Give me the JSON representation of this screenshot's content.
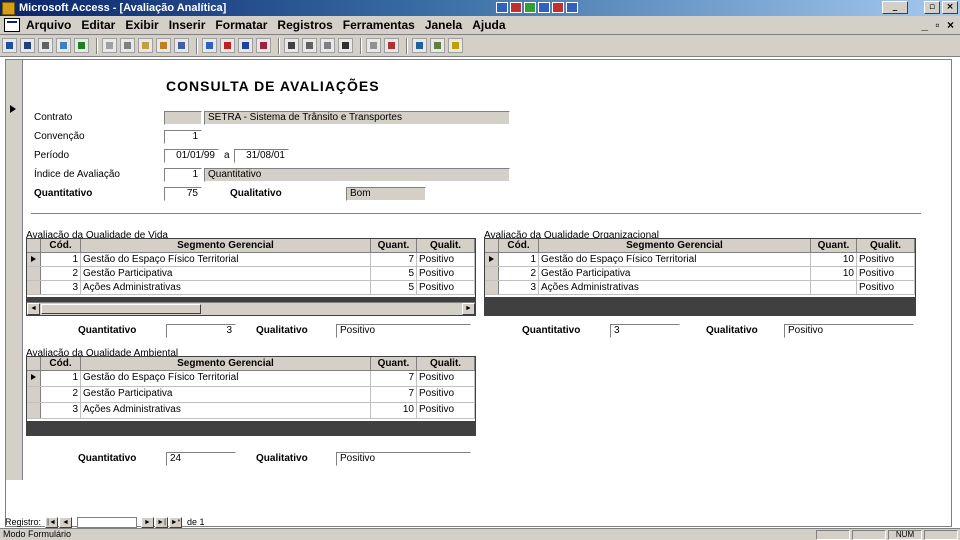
{
  "window": {
    "title": "Microsoft Access - [Avaliação Analítica]",
    "minimize_glyph": "_",
    "restore_glyph": "▫",
    "close_glyph": "×"
  },
  "menu": {
    "items": [
      "Arquivo",
      "Editar",
      "Exibir",
      "Inserir",
      "Formatar",
      "Registros",
      "Ferramentas",
      "Janela",
      "Ajuda"
    ],
    "doc_controls": "_ ▫ ×"
  },
  "form": {
    "title": "CONSULTA DE AVALIAÇÕES",
    "fields": {
      "contrato_label": "Contrato",
      "contrato_code": "",
      "contrato_name": "SETRA - Sistema de Trânsito e Transportes",
      "convencao_label": "Convenção",
      "convencao_value": "1",
      "periodo_label": "Período",
      "periodo_from": "01/01/99",
      "periodo_sep": "a",
      "periodo_to": "31/08/01",
      "indice_label": "Índice de Avaliação",
      "indice_code": "1",
      "indice_name": "Quantitativo",
      "quantitativo_label": "Quantitativo",
      "quantitativo_value": "75",
      "qualitativo_label": "Qualitativo",
      "qualitativo_value": "Bom"
    }
  },
  "subforms": {
    "vida": {
      "caption": "Avaliação da Qualidade de Vida",
      "headers": [
        "Cód.",
        "Segmento Gerencial",
        "Quant.",
        "Qualit."
      ],
      "rows": [
        {
          "cod": "1",
          "seg": "Gestão do Espaço Físico Territorial",
          "qt": "7",
          "ql": "Positivo"
        },
        {
          "cod": "2",
          "seg": "Gestão Participativa",
          "qt": "5",
          "ql": "Positivo"
        },
        {
          "cod": "3",
          "seg": "Ações Administrativas",
          "qt": "5",
          "ql": "Positivo"
        }
      ],
      "quantitativo_label": "Quantitativo",
      "quantitativo_value": "3",
      "qualitativo_label": "Qualitativo",
      "qualitativo_value": "Positivo"
    },
    "organizacional": {
      "caption": "Avaliação da Qualidade Organizacional",
      "headers": [
        "Cód.",
        "Segmento Gerencial",
        "Quant.",
        "Qualit."
      ],
      "rows": [
        {
          "cod": "1",
          "seg": "Gestão do Espaço Físico Territorial",
          "qt": "10",
          "ql": "Positivo"
        },
        {
          "cod": "2",
          "seg": "Gestão Participativa",
          "qt": "10",
          "ql": "Positivo"
        },
        {
          "cod": "3",
          "seg": "Ações Administrativas",
          "qt": "",
          "ql": "Positivo"
        }
      ],
      "quantitativo_label": "Quantitativo",
      "quantitativo_value": "3",
      "qualitativo_label": "Qualitativo",
      "qualitativo_value": "Positivo"
    },
    "ambiental": {
      "caption": "Avaliação da Qualidade Ambiental",
      "headers": [
        "Cód.",
        "Segmento Gerencial",
        "Quant.",
        "Qualit."
      ],
      "rows": [
        {
          "cod": "1",
          "seg": "Gestão do Espaço Físico Territorial",
          "qt": "7",
          "ql": "Positivo"
        },
        {
          "cod": "2",
          "seg": "Gestão Participativa",
          "qt": "7",
          "ql": "Positivo"
        },
        {
          "cod": "3",
          "seg": "Ações Administrativas",
          "qt": "10",
          "ql": "Positivo"
        }
      ],
      "quantitativo_label": "Quantitativo",
      "quantitativo_value": "24",
      "qualitativo_label": "Qualitativo",
      "qualitativo_value": "Positivo"
    }
  },
  "record_nav": {
    "label": "Registro:",
    "first": "|◄",
    "prev": "◄",
    "next": "►",
    "last": "►|",
    "new": "►*",
    "count": "de 1"
  },
  "status": {
    "text": "Modo Formulário",
    "panels": [
      "",
      "",
      "NUM",
      ""
    ]
  },
  "colors": {
    "titlebar_start": "#0a246a",
    "titlebar_end": "#a6caf0",
    "chrome": "#d4d0c8"
  }
}
